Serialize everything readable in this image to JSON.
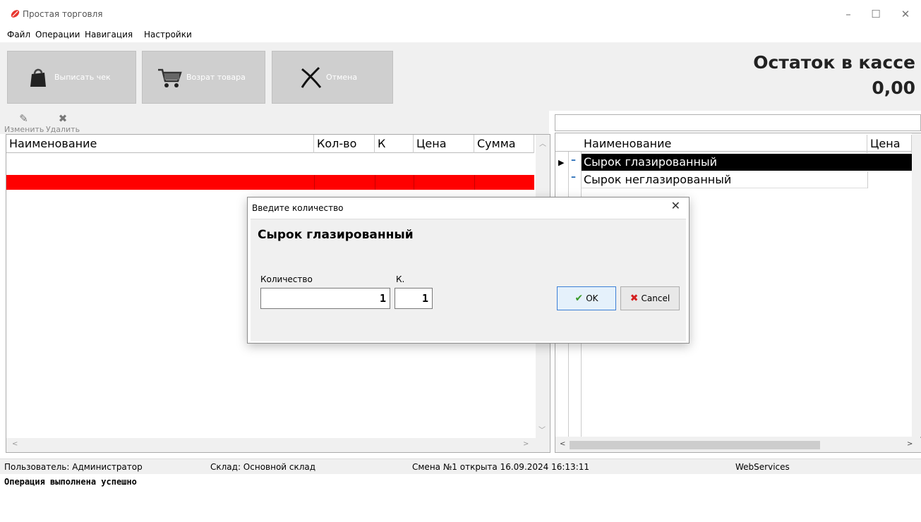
{
  "window": {
    "title": "Простая торговля",
    "minimize_icon": "–",
    "maximize_icon": "☐",
    "close_icon": "✕"
  },
  "menu": [
    "Файл",
    "Операции",
    "Навигация",
    "Настройки"
  ],
  "toolbar": {
    "issue_receipt": "Выписать чек",
    "return_goods": "Возрат товара",
    "cancel": "Отмена"
  },
  "cash": {
    "label": "Остаток в кассе",
    "value": "0,00"
  },
  "subtoolbar": {
    "edit": "Изменить",
    "delete": "Удалить"
  },
  "left_grid": {
    "columns": [
      "Наименование",
      "Кол-во",
      "К",
      "Цена",
      "Сумма"
    ]
  },
  "right_grid": {
    "columns": [
      "Наименование",
      "Цена"
    ],
    "rows": [
      "Сырок глазированный",
      "Сырок неглазированный"
    ]
  },
  "status": {
    "user": "Пользователь: Администратор",
    "warehouse": "Склад: Основной склад",
    "shift": "Смена №1 открыта 16.09.2024 16:13:11",
    "service": "WebServices"
  },
  "log": "Операция выполнена успешно",
  "dialog": {
    "title": "Введите количество",
    "product": "Сырок глазированный",
    "qty_label": "Количество",
    "k_label": "К.",
    "qty_value": "1",
    "k_value": "1",
    "ok_label": "OK",
    "cancel_label": "Cancel"
  },
  "colors": {
    "accent_red": "#ff0000",
    "selected_row": "#000000",
    "ok_check": "#3a9b2a",
    "cancel_x": "#d42020"
  }
}
